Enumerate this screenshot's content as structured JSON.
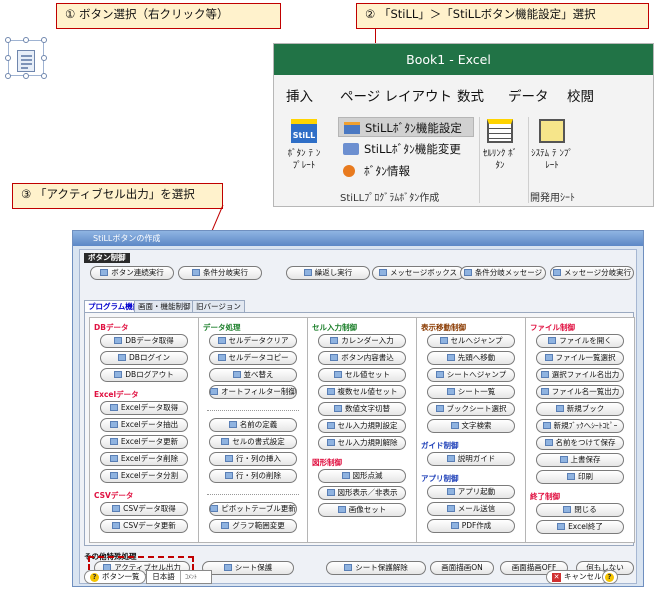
{
  "callouts": {
    "step1": "① ボタン選択（右クリック等）",
    "step2": "② 「StiLL」＞「StiLLボタン機能設定」選択",
    "step3": "③ 「アクティブセル出力」を選択"
  },
  "excel": {
    "title": "Book1  -  Excel",
    "tabs": [
      "挿入",
      "ページ レイアウト",
      "数式",
      "データ",
      "校閲"
    ],
    "still_icon_text": "StiLL",
    "btn_template_label": "ﾎﾞﾀﾝ ﾃ ﾝﾌﾟﾚｰﾄ",
    "menu": [
      "StiLLﾎﾞﾀﾝ機能設定",
      "StiLLﾎﾞﾀﾝ機能変更",
      "ﾎﾞﾀﾝ情報"
    ],
    "cell_link_label": "ｾﾙﾘﾝｸ ﾎﾞﾀﾝ",
    "system_label": "ｼｽﾃﾑ ﾃ ﾝﾌﾟﾚｰﾄ",
    "group1": "StiLLﾌﾟﾛｸﾞﾗﾑﾎﾞﾀﾝ作成",
    "group2": "開発用ｼｰﾄ"
  },
  "dialog": {
    "title": "StiLLボタンの作成",
    "button_control_label": "ボタン制御",
    "top_buttons": [
      "ボタン連続実行",
      "条件分岐実行",
      "繰返し実行",
      "メッセージボックス",
      "条件分岐メッセージ",
      "メッセージ分岐実行"
    ],
    "tabs": [
      "プログラム機能",
      "画面・機能制御",
      "旧バージョン"
    ],
    "columns": [
      {
        "sections": [
          {
            "title": "DBデータ",
            "color": "red",
            "items": [
              "DBデータ取得",
              "DBログイン",
              "DBログアウト"
            ]
          },
          {
            "title": "Excelデータ",
            "color": "red",
            "items": [
              "Excelデータ取得",
              "Excelデータ抽出",
              "Excelデータ更新",
              "Excelデータ削除",
              "Excelデータ分割"
            ]
          },
          {
            "title": "CSVデータ",
            "color": "red",
            "items": [
              "CSVデータ取得",
              "CSVデータ更新"
            ]
          }
        ]
      },
      {
        "sections": [
          {
            "title": "データ処理",
            "color": "green",
            "items": [
              "セルデータクリア",
              "セルデータコピー",
              "並べ替え",
              "オートフィルター制御"
            ]
          },
          {
            "title": "",
            "color": "green",
            "items": [
              "名前の定義",
              "セルの書式設定",
              "行・列の挿入",
              "行・列の削除"
            ]
          },
          {
            "title": "",
            "color": "green",
            "items": [
              "ピボットテーブル更新",
              "グラフ範囲変更"
            ]
          }
        ]
      },
      {
        "sections": [
          {
            "title": "セル入力制御",
            "color": "green",
            "items": [
              "カレンダー入力",
              "ボタン内容書込",
              "セル値セット",
              "複数セル値セット",
              "数値文字切替",
              "セル入力規則設定",
              "セル入力規則解除"
            ]
          },
          {
            "title": "図形制御",
            "color": "red",
            "items": [
              "図形点滅",
              "図形表示／非表示",
              "画像セット"
            ]
          }
        ]
      },
      {
        "sections": [
          {
            "title": "表示移動制御",
            "color": "brown",
            "items": [
              "セルへジャンプ",
              "先頭へ移動",
              "シートへジャンプ",
              "シート一覧",
              "ブックシート選択",
              "文字検索"
            ]
          },
          {
            "title": "ガイド制御",
            "color": "blue",
            "items": [
              "説明ガイド"
            ]
          },
          {
            "title": "アプリ制御",
            "color": "blue",
            "items": [
              "アプリ起動",
              "メール送信",
              "PDF作成"
            ]
          }
        ]
      },
      {
        "sections": [
          {
            "title": "ファイル制御",
            "color": "red",
            "items": [
              "ファイルを開く",
              "ファイル一覧選択",
              "選択ファイル名出力",
              "ファイル名一覧出力",
              "新規ブック",
              "新規ﾌﾞｯｸへｼｰﾄｺﾋﾟｰ",
              "名前をつけて保存",
              "上書保存",
              "印刷"
            ]
          },
          {
            "title": "終了制御",
            "color": "red",
            "items": [
              "閉じる",
              "Excel終了"
            ]
          }
        ]
      }
    ],
    "other_title": "その他特殊処理",
    "other_buttons": [
      "アクティブセル出力",
      "シート保護",
      "シート保護解除",
      "画面描画ON",
      "画面描画OFF",
      "何もしない"
    ],
    "footer": {
      "list_button": "ボタン一覧",
      "lang": "日本語",
      "comment": "ｺﾒﾝﾄ",
      "cancel": "キャンセル"
    }
  }
}
